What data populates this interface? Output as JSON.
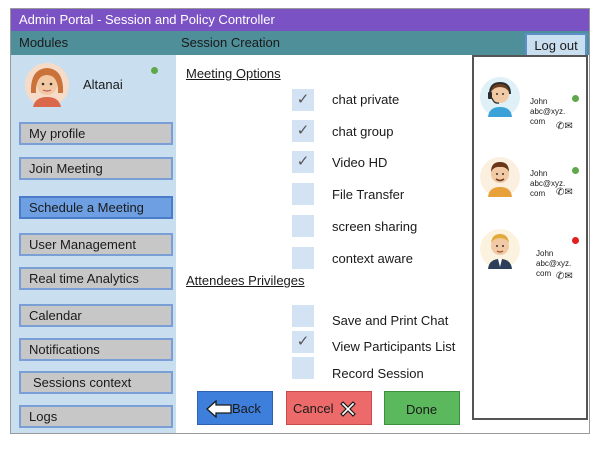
{
  "window": {
    "title": "Admin Portal - Session and Policy Controller"
  },
  "header": {
    "modules_label": "Modules",
    "section_label": "Session Creation",
    "logout_label": "Log out"
  },
  "profile": {
    "name": "Altanai",
    "status_color": "#5fa84a"
  },
  "sidebar": {
    "items": [
      {
        "label": "My profile"
      },
      {
        "label": "Join Meeting"
      },
      {
        "label": "Schedule a Meeting",
        "active": true
      },
      {
        "label": "User Management"
      },
      {
        "label": "Real time Analytics"
      },
      {
        "label": "Calendar"
      },
      {
        "label": "Notifications"
      },
      {
        "label": "Sessions context"
      },
      {
        "label": "Logs"
      }
    ]
  },
  "meeting_options": {
    "title": "Meeting Options",
    "items": [
      {
        "label": "chat private",
        "checked": true
      },
      {
        "label": "chat group",
        "checked": true
      },
      {
        "label": "Video HD",
        "checked": true
      },
      {
        "label": "File Transfer",
        "checked": false
      },
      {
        "label": "screen sharing",
        "checked": false
      },
      {
        "label": "context aware",
        "checked": false
      }
    ]
  },
  "attendees": {
    "title": "Attendees Privileges",
    "items": [
      {
        "label": "Save and Print Chat",
        "checked": false
      },
      {
        "label": "View Participants List",
        "checked": true
      },
      {
        "label": "Record Session",
        "checked": false
      }
    ]
  },
  "buttons": {
    "back_label": "Back",
    "cancel_label": "Cancel",
    "done_label": "Done"
  },
  "contacts": [
    {
      "name": "John",
      "email_line1": "abc@xyz.",
      "email_line2": "com",
      "status_color": "#5fa84a"
    },
    {
      "name": "John",
      "email_line1": "abc@xyz.",
      "email_line2": "com",
      "status_color": "#5fa84a"
    },
    {
      "name": "John",
      "email_line1": "abc@xyz.",
      "email_line2": "com",
      "status_color": "#e02020"
    }
  ],
  "check_mark": "✓",
  "icons": {
    "phone": "phone-icon",
    "mail": "mail-icon"
  }
}
